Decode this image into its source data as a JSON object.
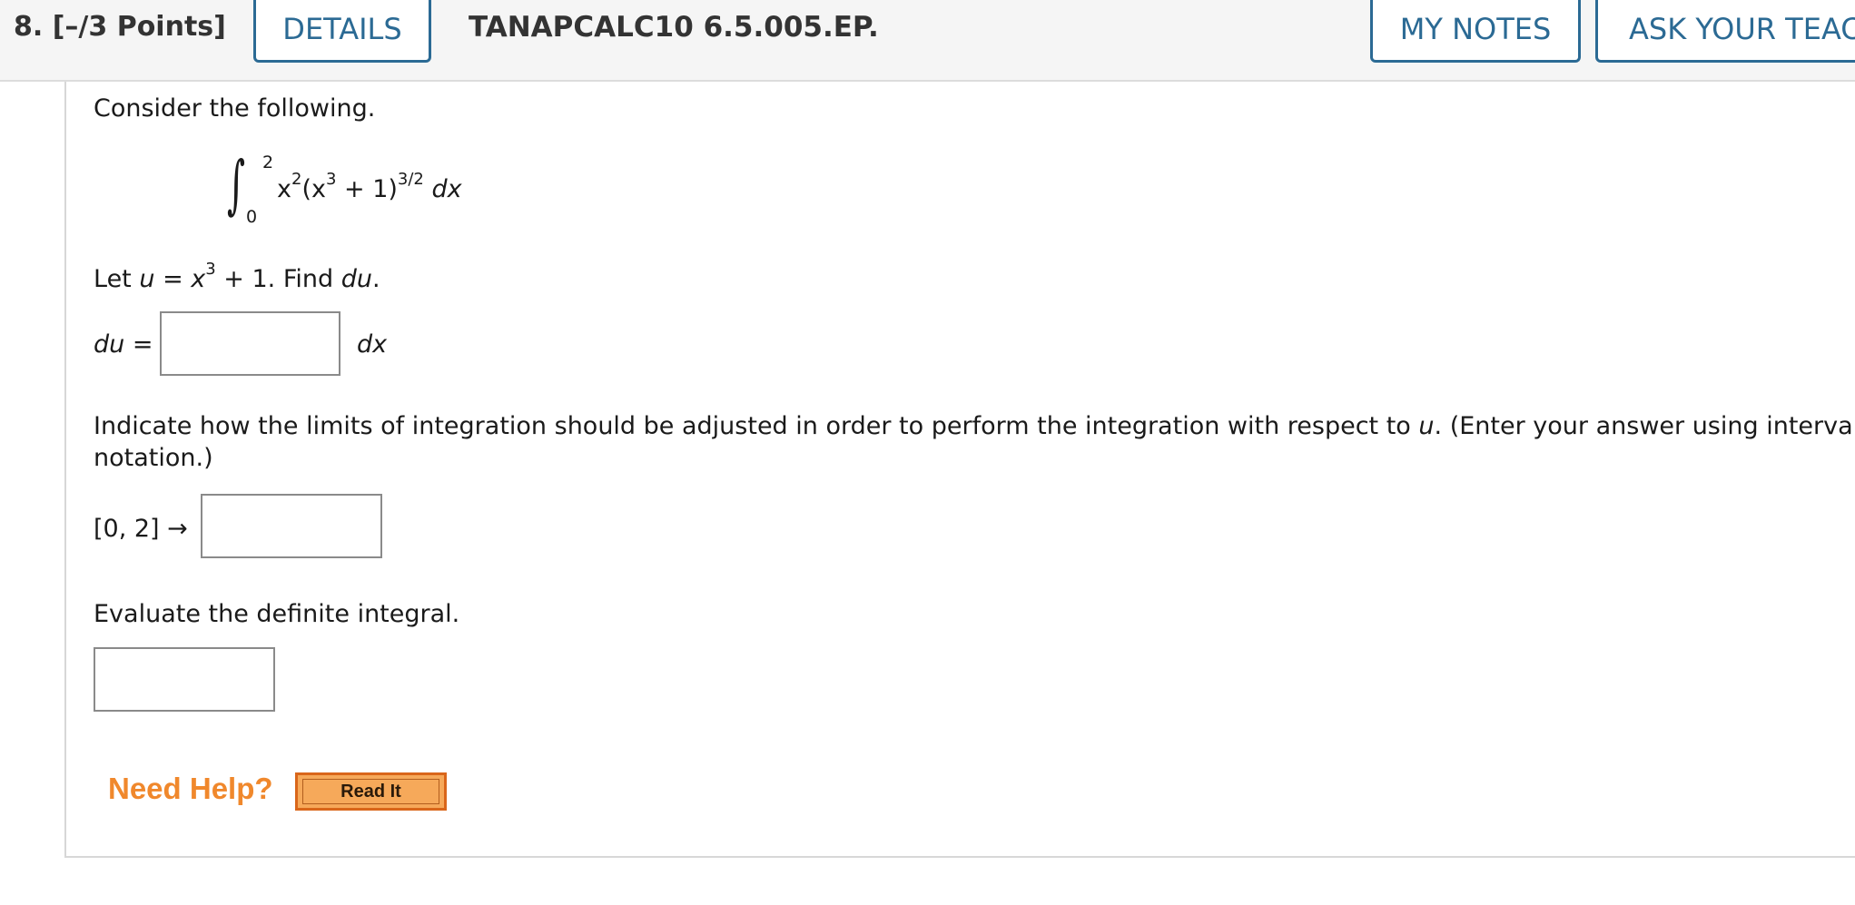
{
  "header": {
    "question_number": "8.  [–/3 Points]",
    "details_label": "DETAILS",
    "question_id": "TANAPCALC10 6.5.005.EP.",
    "my_notes_label": "MY NOTES",
    "ask_teacher_label": "ASK YOUR TEACHER"
  },
  "question": {
    "intro": "Consider the following.",
    "integral": {
      "upper_limit": "2",
      "lower_limit": "0",
      "integrand_x": "x",
      "integrand_x_exp": "2",
      "integrand_open": "(x",
      "integrand_inner_exp": "3",
      "integrand_rest": " + 1)",
      "integrand_outer_exp": "3/2",
      "differential": "dx"
    },
    "let_prefix": "Let ",
    "let_var": "u",
    "let_eq": " = ",
    "let_x": "x",
    "let_exp": "3",
    "let_suffix": " + 1. Find ",
    "let_du": "du",
    "let_end": ".",
    "du_label": "du",
    "du_eq": " =",
    "du_unit": "dx",
    "limits_instruction_1_prefix": "Indicate how the limits of integration should be adjusted in order to perform the integration with respect to ",
    "limits_instruction_1_var": "u",
    "limits_instruction_1_suffix": ". (Enter your answer using interval",
    "limits_instruction_2": "notation.)",
    "interval_label": "[0, 2] →",
    "evaluate_label": "Evaluate the definite integral."
  },
  "answers": {
    "du_value": "",
    "interval_value": "",
    "integral_value": ""
  },
  "help": {
    "need_help_label": "Need Help?",
    "read_it_label": "Read It"
  },
  "colors": {
    "header_blue": "#2b6a94",
    "need_help_orange": "#f0882c",
    "read_it_fill": "#f6a95a"
  }
}
